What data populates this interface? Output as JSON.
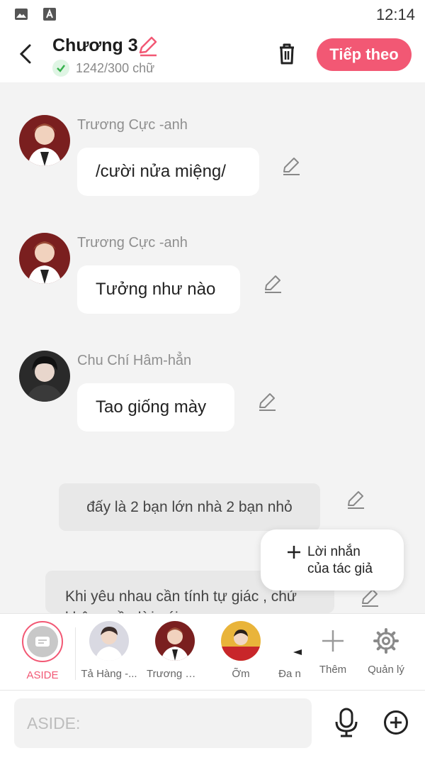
{
  "status": {
    "time": "12:14"
  },
  "header": {
    "title": "Chương 3",
    "word_count": "1242/300 chữ",
    "next_label": "Tiếp theo"
  },
  "messages": [
    {
      "name": "Trương Cực -anh",
      "text": "/cười nửa miệng/"
    },
    {
      "name": "Trương Cực -anh",
      "text": "Tưởng như nào"
    },
    {
      "name": "Chu Chí Hâm-hẳn",
      "text": "Tao giống mày"
    }
  ],
  "asides": [
    {
      "text": "đấy là 2 bạn lớn nhà 2 bạn nhỏ"
    },
    {
      "line1": "Khi yêu nhau cần tính tự giác , chứ",
      "line2": "không cần lời nói"
    }
  ],
  "author_note": {
    "line1": "Lời nhắn",
    "line2": "của tác giả"
  },
  "characters": {
    "aside_label": "ASIDE",
    "items": [
      "Tả Hàng -...",
      "Trương Cự...",
      "Ỡm",
      "Đa n"
    ],
    "add_label": "Thêm",
    "manage_label": "Quản lý"
  },
  "composer": {
    "placeholder": "ASIDE:"
  },
  "colors": {
    "accent": "#f25874",
    "check": "#37b24d"
  }
}
